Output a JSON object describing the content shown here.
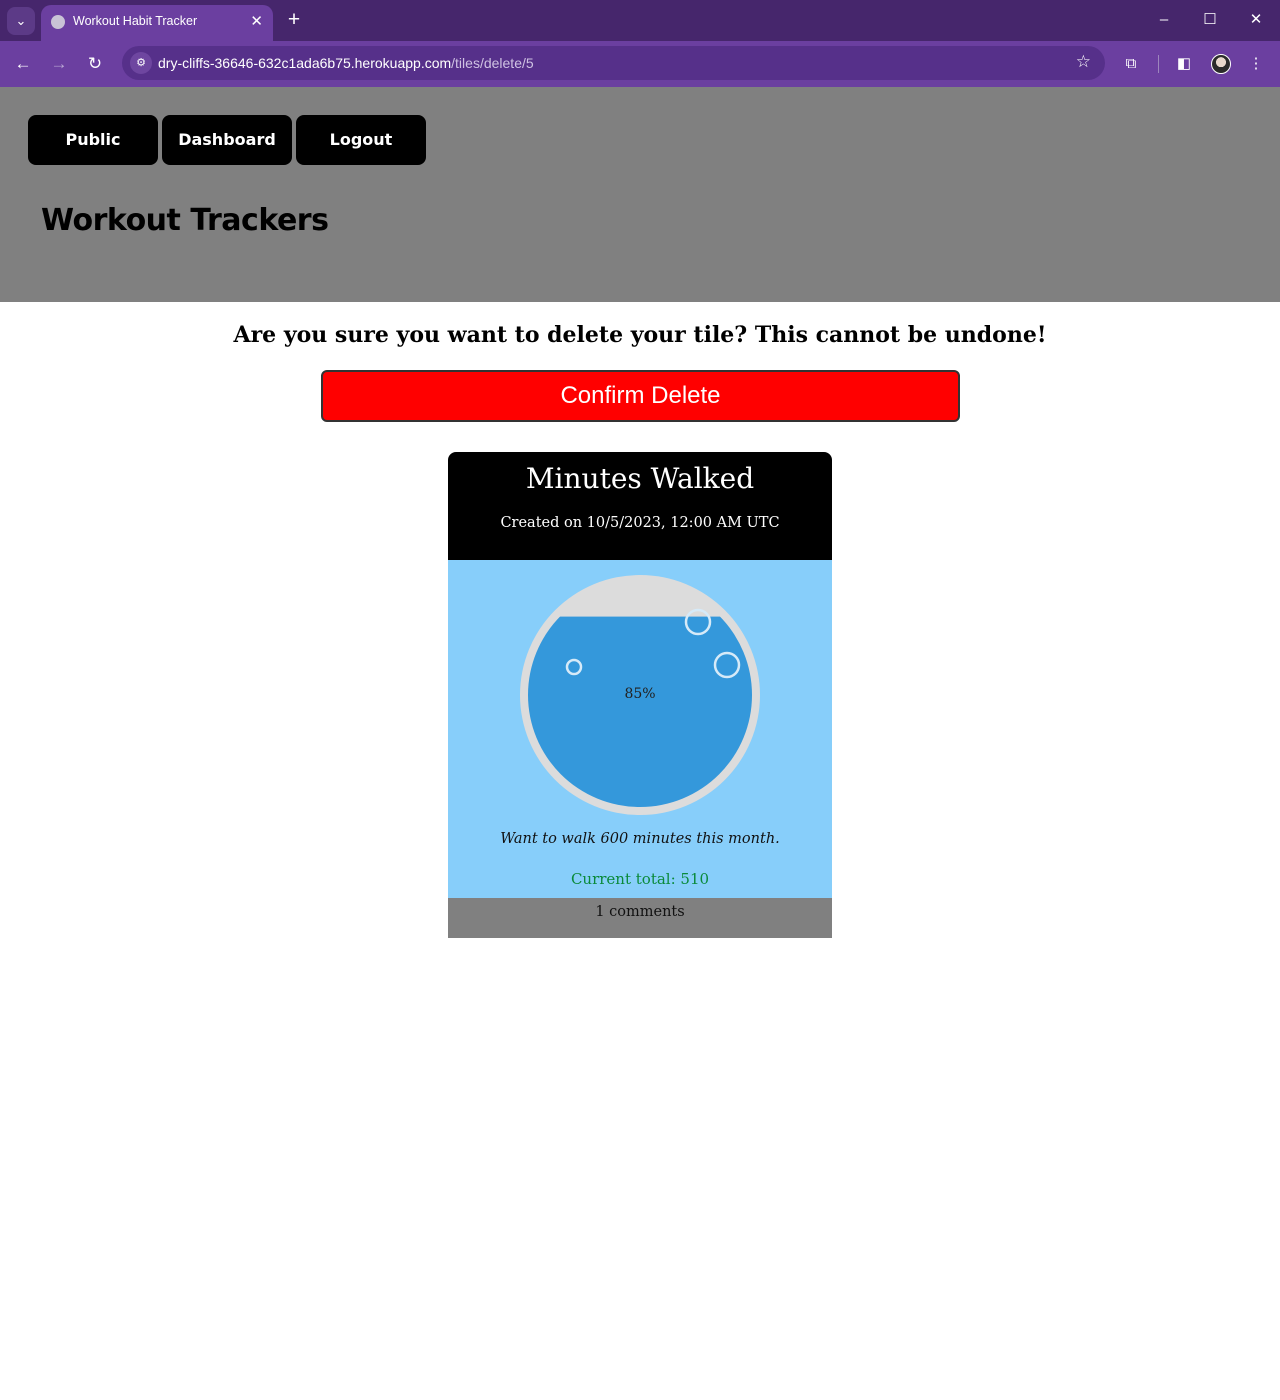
{
  "browser": {
    "tab_title": "Workout Habit Tracker",
    "url_host": "dry-cliffs-36646-632c1ada6b75.herokuapp.com",
    "url_path": "/tiles/delete/5",
    "colors": {
      "tabbar": "#46266c",
      "toolbar": "#6b3fa0"
    }
  },
  "header": {
    "nav": [
      {
        "label": "Public"
      },
      {
        "label": "Dashboard"
      },
      {
        "label": "Logout"
      }
    ],
    "title": "Workout Trackers",
    "background": "#808080"
  },
  "confirm": {
    "message": "Are you sure you want to delete your tile? This cannot be undone!",
    "button_label": "Confirm Delete",
    "button_color": "#ff0000"
  },
  "tile": {
    "title": "Minutes Walked",
    "created": "Created on 10/5/2023, 12:00 AM UTC",
    "progress": 0.85,
    "progress_label": "85%",
    "goal_text": "Want to walk 600 minutes this month.",
    "total_text": "Current total: 510",
    "comments_text": "1 comments",
    "colors": {
      "body": "#87cefa",
      "water": "#3498db",
      "total_text": "#0a8a3a"
    }
  }
}
